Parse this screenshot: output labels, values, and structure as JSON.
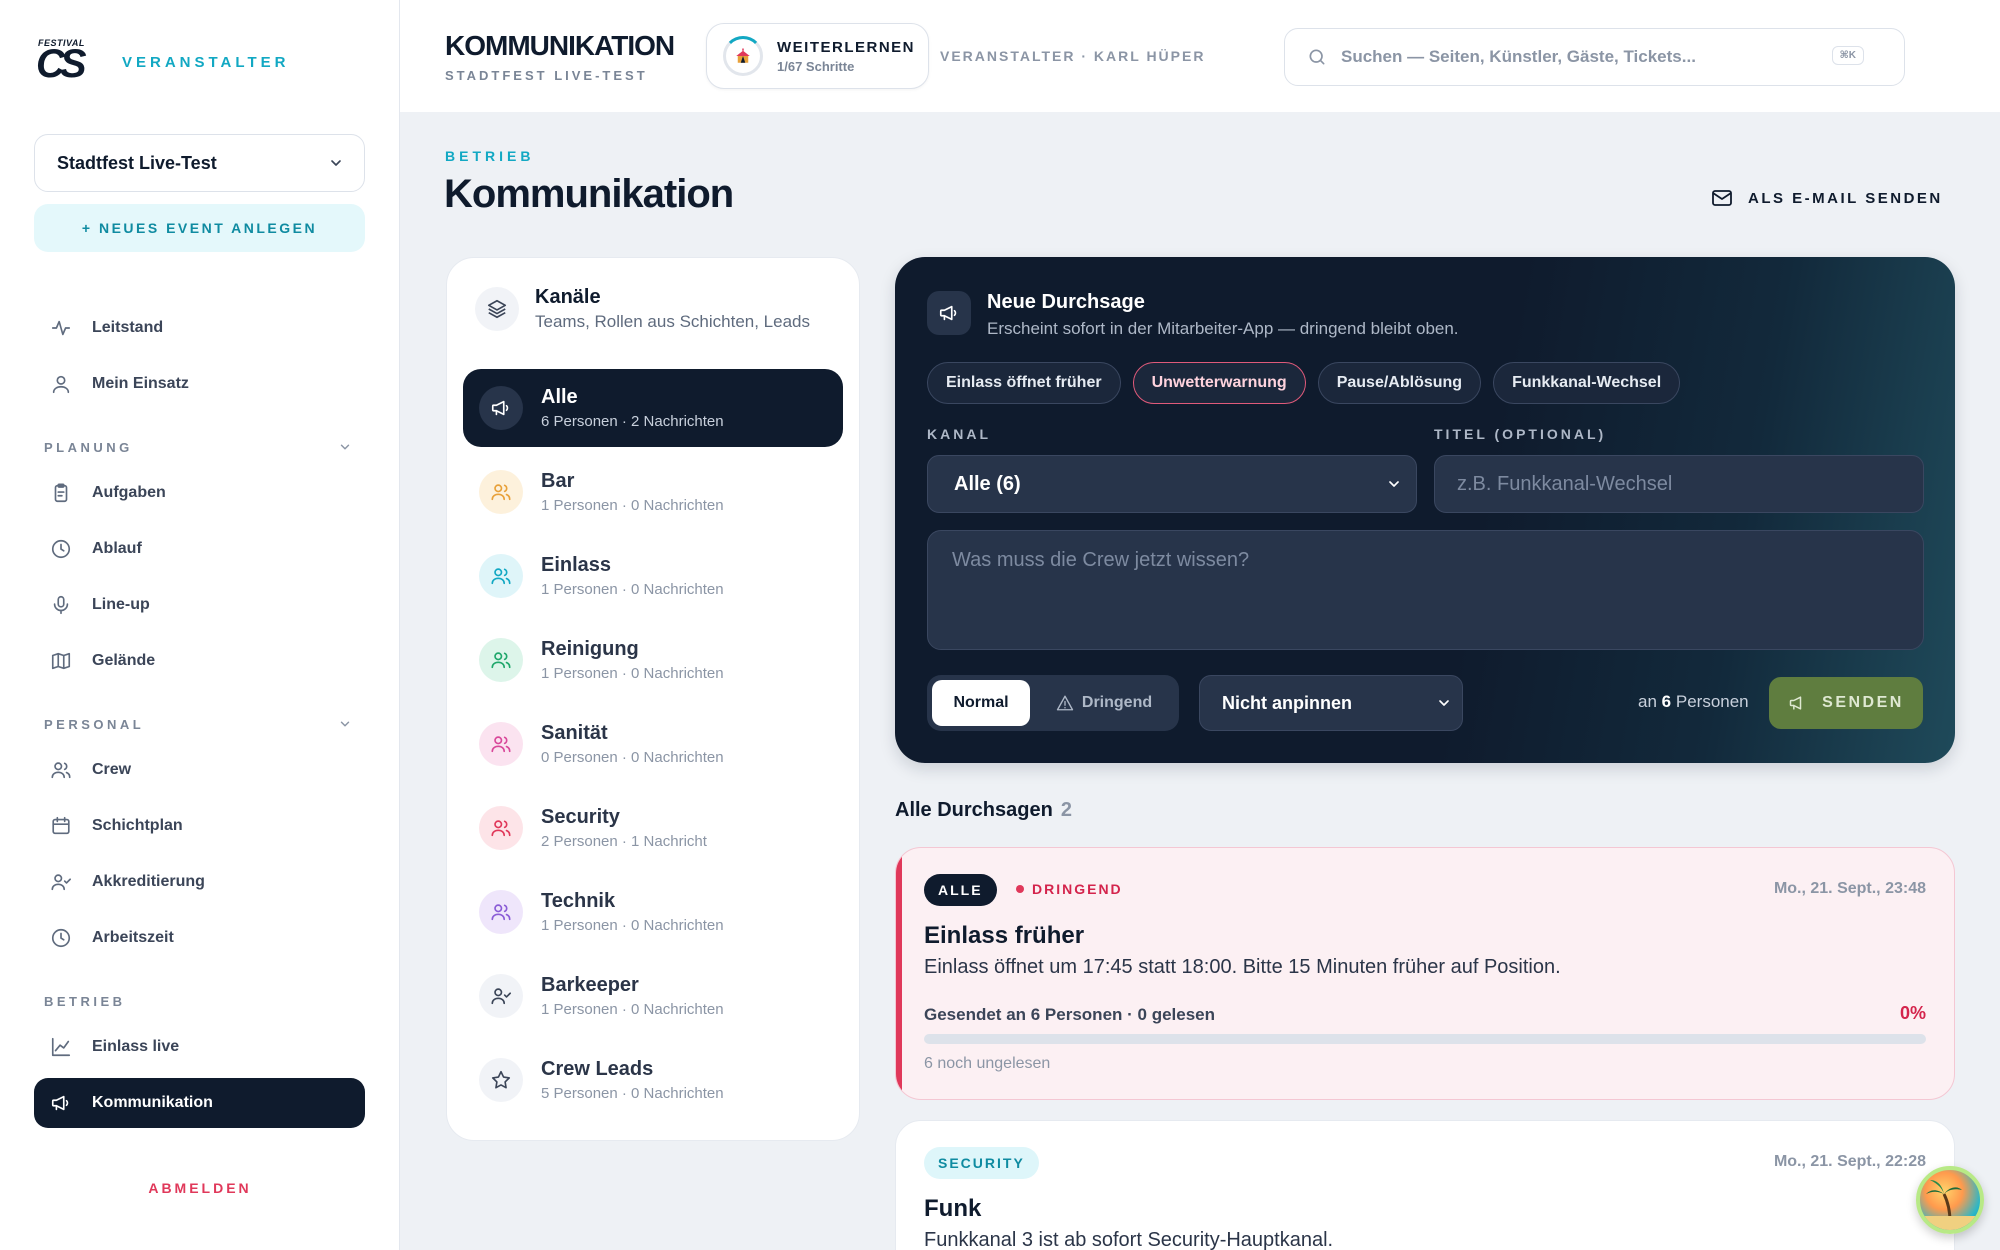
{
  "brand": {
    "logo_top": "FESTIVAL",
    "logo_main": "CS",
    "role_label": "VERANSTALTER"
  },
  "sidebar": {
    "event_select": "Stadtfest Live-Test",
    "new_event": "+ NEUES EVENT ANLEGEN",
    "top_items": [
      {
        "label": "Leitstand",
        "icon": "activity-icon"
      },
      {
        "label": "Mein Einsatz",
        "icon": "user-icon"
      }
    ],
    "sections": [
      {
        "label": "PLANUNG",
        "items": [
          {
            "label": "Aufgaben",
            "icon": "clipboard-icon"
          },
          {
            "label": "Ablauf",
            "icon": "clock-icon"
          },
          {
            "label": "Line-up",
            "icon": "microphone-icon"
          },
          {
            "label": "Gelände",
            "icon": "map-icon"
          }
        ]
      },
      {
        "label": "PERSONAL",
        "items": [
          {
            "label": "Crew",
            "icon": "users-icon"
          },
          {
            "label": "Schichtplan",
            "icon": "calendar-icon"
          },
          {
            "label": "Akkreditierung",
            "icon": "user-check-icon"
          },
          {
            "label": "Arbeitszeit",
            "icon": "clock-icon"
          }
        ]
      },
      {
        "label": "BETRIEB",
        "items": [
          {
            "label": "Einlass live",
            "icon": "line-chart-icon"
          },
          {
            "label": "Kommunikation",
            "icon": "megaphone-icon",
            "active": true
          }
        ]
      }
    ],
    "logout": "ABMELDEN"
  },
  "topbar": {
    "title": "KOMMUNIKATION",
    "subtitle": "STADTFEST LIVE-TEST",
    "learn_title": "WEITERLERNEN",
    "learn_progress": "1/67 Schritte",
    "user": "VERANSTALTER · KARL HÜPER",
    "search_placeholder": "Suchen — Seiten, Künstler, Gäste, Tickets...",
    "search_shortcut": "⌘K"
  },
  "page": {
    "eyebrow": "BETRIEB",
    "title": "Kommunikation",
    "email_button": "ALS E-MAIL SENDEN"
  },
  "channels": {
    "title": "Kanäle",
    "subtitle": "Teams, Rollen aus Schichten, Leads",
    "items": [
      {
        "name": "Alle",
        "meta": "6 Personen · 2 Nachrichten",
        "icon": "megaphone-icon",
        "active": true,
        "color": "#ffffff",
        "bg": "#27344a"
      },
      {
        "name": "Bar",
        "meta": "1 Personen · 0 Nachrichten",
        "icon": "users-icon",
        "color": "#e8a13a",
        "bg": "#fdf1dc"
      },
      {
        "name": "Einlass",
        "meta": "1 Personen · 0 Nachrichten",
        "icon": "users-icon",
        "color": "#12a8c3",
        "bg": "#dff5f9"
      },
      {
        "name": "Reinigung",
        "meta": "1 Personen · 0 Nachrichten",
        "icon": "users-icon",
        "color": "#1fa76b",
        "bg": "#ddf5ea"
      },
      {
        "name": "Sanität",
        "meta": "0 Personen · 0 Nachrichten",
        "icon": "users-icon",
        "color": "#d9489a",
        "bg": "#fbe3f0"
      },
      {
        "name": "Security",
        "meta": "2 Personen · 1 Nachricht",
        "icon": "users-icon",
        "color": "#e0385a",
        "bg": "#fde4e8"
      },
      {
        "name": "Technik",
        "meta": "1 Personen · 0 Nachrichten",
        "icon": "users-icon",
        "color": "#8a5cd6",
        "bg": "#efe6fb"
      },
      {
        "name": "Barkeeper",
        "meta": "1 Personen · 0 Nachrichten",
        "icon": "user-check-icon",
        "color": "#3b4558",
        "bg": "#f1f3f7"
      },
      {
        "name": "Crew Leads",
        "meta": "5 Personen · 0 Nachrichten",
        "icon": "star-icon",
        "color": "#3b4558",
        "bg": "#f1f3f7"
      }
    ]
  },
  "compose": {
    "title": "Neue Durchsage",
    "subtitle": "Erscheint sofort in der Mitarbeiter-App — dringend bleibt oben.",
    "chips": [
      "Einlass öffnet früher",
      "Unwetterwarnung",
      "Pause/Ablösung",
      "Funkkanal-Wechsel"
    ],
    "kanal_label": "KANAL",
    "kanal_value": "Alle (6)",
    "titel_label": "TITEL (OPTIONAL)",
    "titel_placeholder": "z.B. Funkkanal-Wechsel",
    "message_placeholder": "Was muss die Crew jetzt wissen?",
    "priority_normal": "Normal",
    "priority_urgent": "Dringend",
    "pin_value": "Nicht anpinnen",
    "recipients_prefix": "an",
    "recipients_count": "6",
    "recipients_suffix": "Personen",
    "send": "SENDEN"
  },
  "announcements": {
    "heading": "Alle Durchsagen",
    "count": "2",
    "items": [
      {
        "channel": "ALLE",
        "urgent_label": "DRINGEND",
        "date": "Mo., 21. Sept., 23:48",
        "title": "Einlass früher",
        "body": "Einlass öffnet um 17:45 statt 18:00. Bitte 15 Minuten früher auf Position.",
        "stat": "Gesendet an 6 Personen · 0 gelesen",
        "percent": "0%",
        "read_fraction": 0,
        "unread": "6 noch ungelesen"
      },
      {
        "channel": "SECURITY",
        "date": "Mo., 21. Sept., 22:28",
        "title": "Funk",
        "body": "Funkkanal 3 ist ab sofort Security-Hauptkanal."
      }
    ]
  }
}
